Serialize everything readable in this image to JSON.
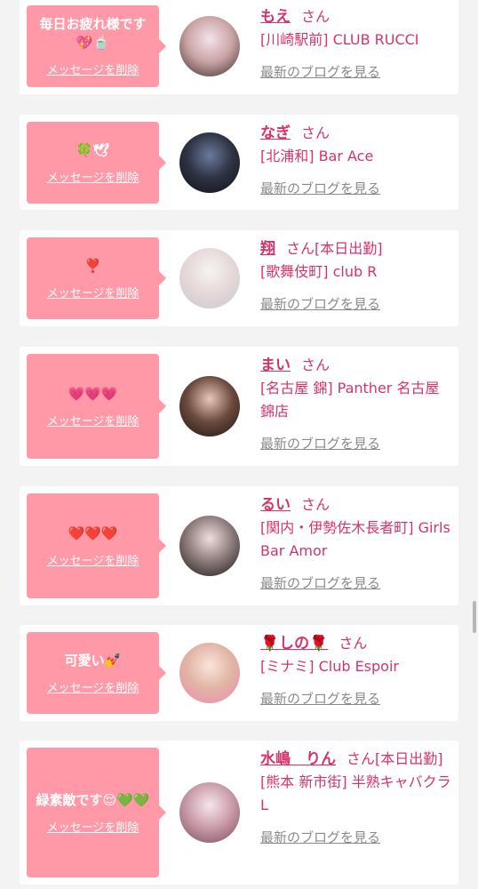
{
  "cards": [
    {
      "message": "毎日お疲れ様です💖🍵",
      "delete_label": "メッセージを削除",
      "name": "もえ",
      "san": "さん",
      "status": "",
      "shop": "[川崎駅前] CLUB RUCCI",
      "blog_label": "最新のブログを見る",
      "avatar_colors": [
        "#f4e3ea",
        "#c9a3a5",
        "#3a2a2a"
      ]
    },
    {
      "message": "🍀🕊",
      "delete_label": "メッセージを削除",
      "name": "なぎ",
      "san": "さん",
      "status": "",
      "shop": "[北浦和] Bar Ace",
      "blog_label": "最新のブログを見る",
      "avatar_colors": [
        "#6a7b9c",
        "#2e3242",
        "#0f1116"
      ]
    },
    {
      "message": "❣️",
      "delete_label": "メッセージを削除",
      "name": "翔",
      "san": "さん",
      "status": "[本日出勤]",
      "shop": "[歌舞伎町] club R",
      "blog_label": "最新のブログを見る",
      "avatar_colors": [
        "#f7f3f3",
        "#e6d8d8",
        "#c7c7cf"
      ]
    },
    {
      "message": "💗💗💗",
      "delete_label": "メッセージを削除",
      "name": "まい",
      "san": "さん",
      "status": "",
      "shop": "[名古屋 錦] Panther 名古屋錦店",
      "blog_label": "最新のブログを見る",
      "avatar_colors": [
        "#e8c8b8",
        "#6b4a3e",
        "#1c1412"
      ]
    },
    {
      "message": "❤️❤️❤️",
      "delete_label": "メッセージを削除",
      "name": "るい",
      "san": "さん",
      "status": "",
      "shop": "[関内・伊勢佐木長者町] Girls Bar Amor",
      "blog_label": "最新のブログを見る",
      "avatar_colors": [
        "#f0dede",
        "#8c7a7a",
        "#191919"
      ]
    },
    {
      "message": "可愛い💅",
      "delete_label": "メッセージを削除",
      "name": "🌹しの🌹",
      "san": "さん",
      "status": "",
      "shop": "[ミナミ] Club Espoir",
      "blog_label": "最新のブログを見る",
      "avatar_colors": [
        "#fbe4dc",
        "#e0b4a4",
        "#f08ab0"
      ]
    },
    {
      "message": "緑素敵です😌💚💚",
      "delete_label": "メッセージを削除",
      "name": "水嶋　りん",
      "san": "さん",
      "status": "[本日出勤]",
      "shop": "[熊本 新市街] 半熟キャバクラ L",
      "blog_label": "最新のブログを見る",
      "avatar_colors": [
        "#f6e6ec",
        "#c99aa8",
        "#7a4a56"
      ]
    }
  ]
}
